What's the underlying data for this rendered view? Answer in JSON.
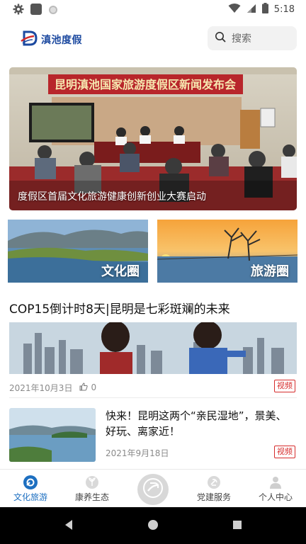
{
  "status_bar": {
    "time": "5:18",
    "icons": [
      "settings-icon",
      "app-square-icon",
      "circle-icon",
      "wifi-icon",
      "signal-icon",
      "battery-icon"
    ]
  },
  "header": {
    "logo_text": "滇池度假",
    "search_placeholder": "搜索"
  },
  "hero": {
    "banner_text": "昆明滇池国家旅游度假区新闻发布会",
    "caption": "度假区首届文化旅游健康创新创业大赛启动"
  },
  "categories": [
    {
      "label": "文化圈"
    },
    {
      "label": "旅游圈"
    }
  ],
  "articles": [
    {
      "title": "COP15倒计时8天|昆明是七彩斑斓的未来",
      "date": "2021年10月3日",
      "likes": "0",
      "tag": "视频"
    },
    {
      "title": "快来！昆明这两个“亲民湿地”，景美、好玩、离家近！",
      "date": "2021年9月18日",
      "tag": "视频"
    }
  ],
  "bottom_nav": {
    "items": [
      {
        "label": "文化旅游",
        "icon": "culture-tourism-icon",
        "active": true
      },
      {
        "label": "康养生态",
        "icon": "eco-health-icon",
        "active": false
      },
      {
        "label": "",
        "icon": "center-logo-icon",
        "active": false
      },
      {
        "label": "党建服务",
        "icon": "party-service-icon",
        "active": false
      },
      {
        "label": "个人中心",
        "icon": "profile-icon",
        "active": false
      }
    ]
  },
  "colors": {
    "accent": "#1d6fc0",
    "tag_red": "#d62b2b",
    "banner_red": "#b8262b"
  }
}
